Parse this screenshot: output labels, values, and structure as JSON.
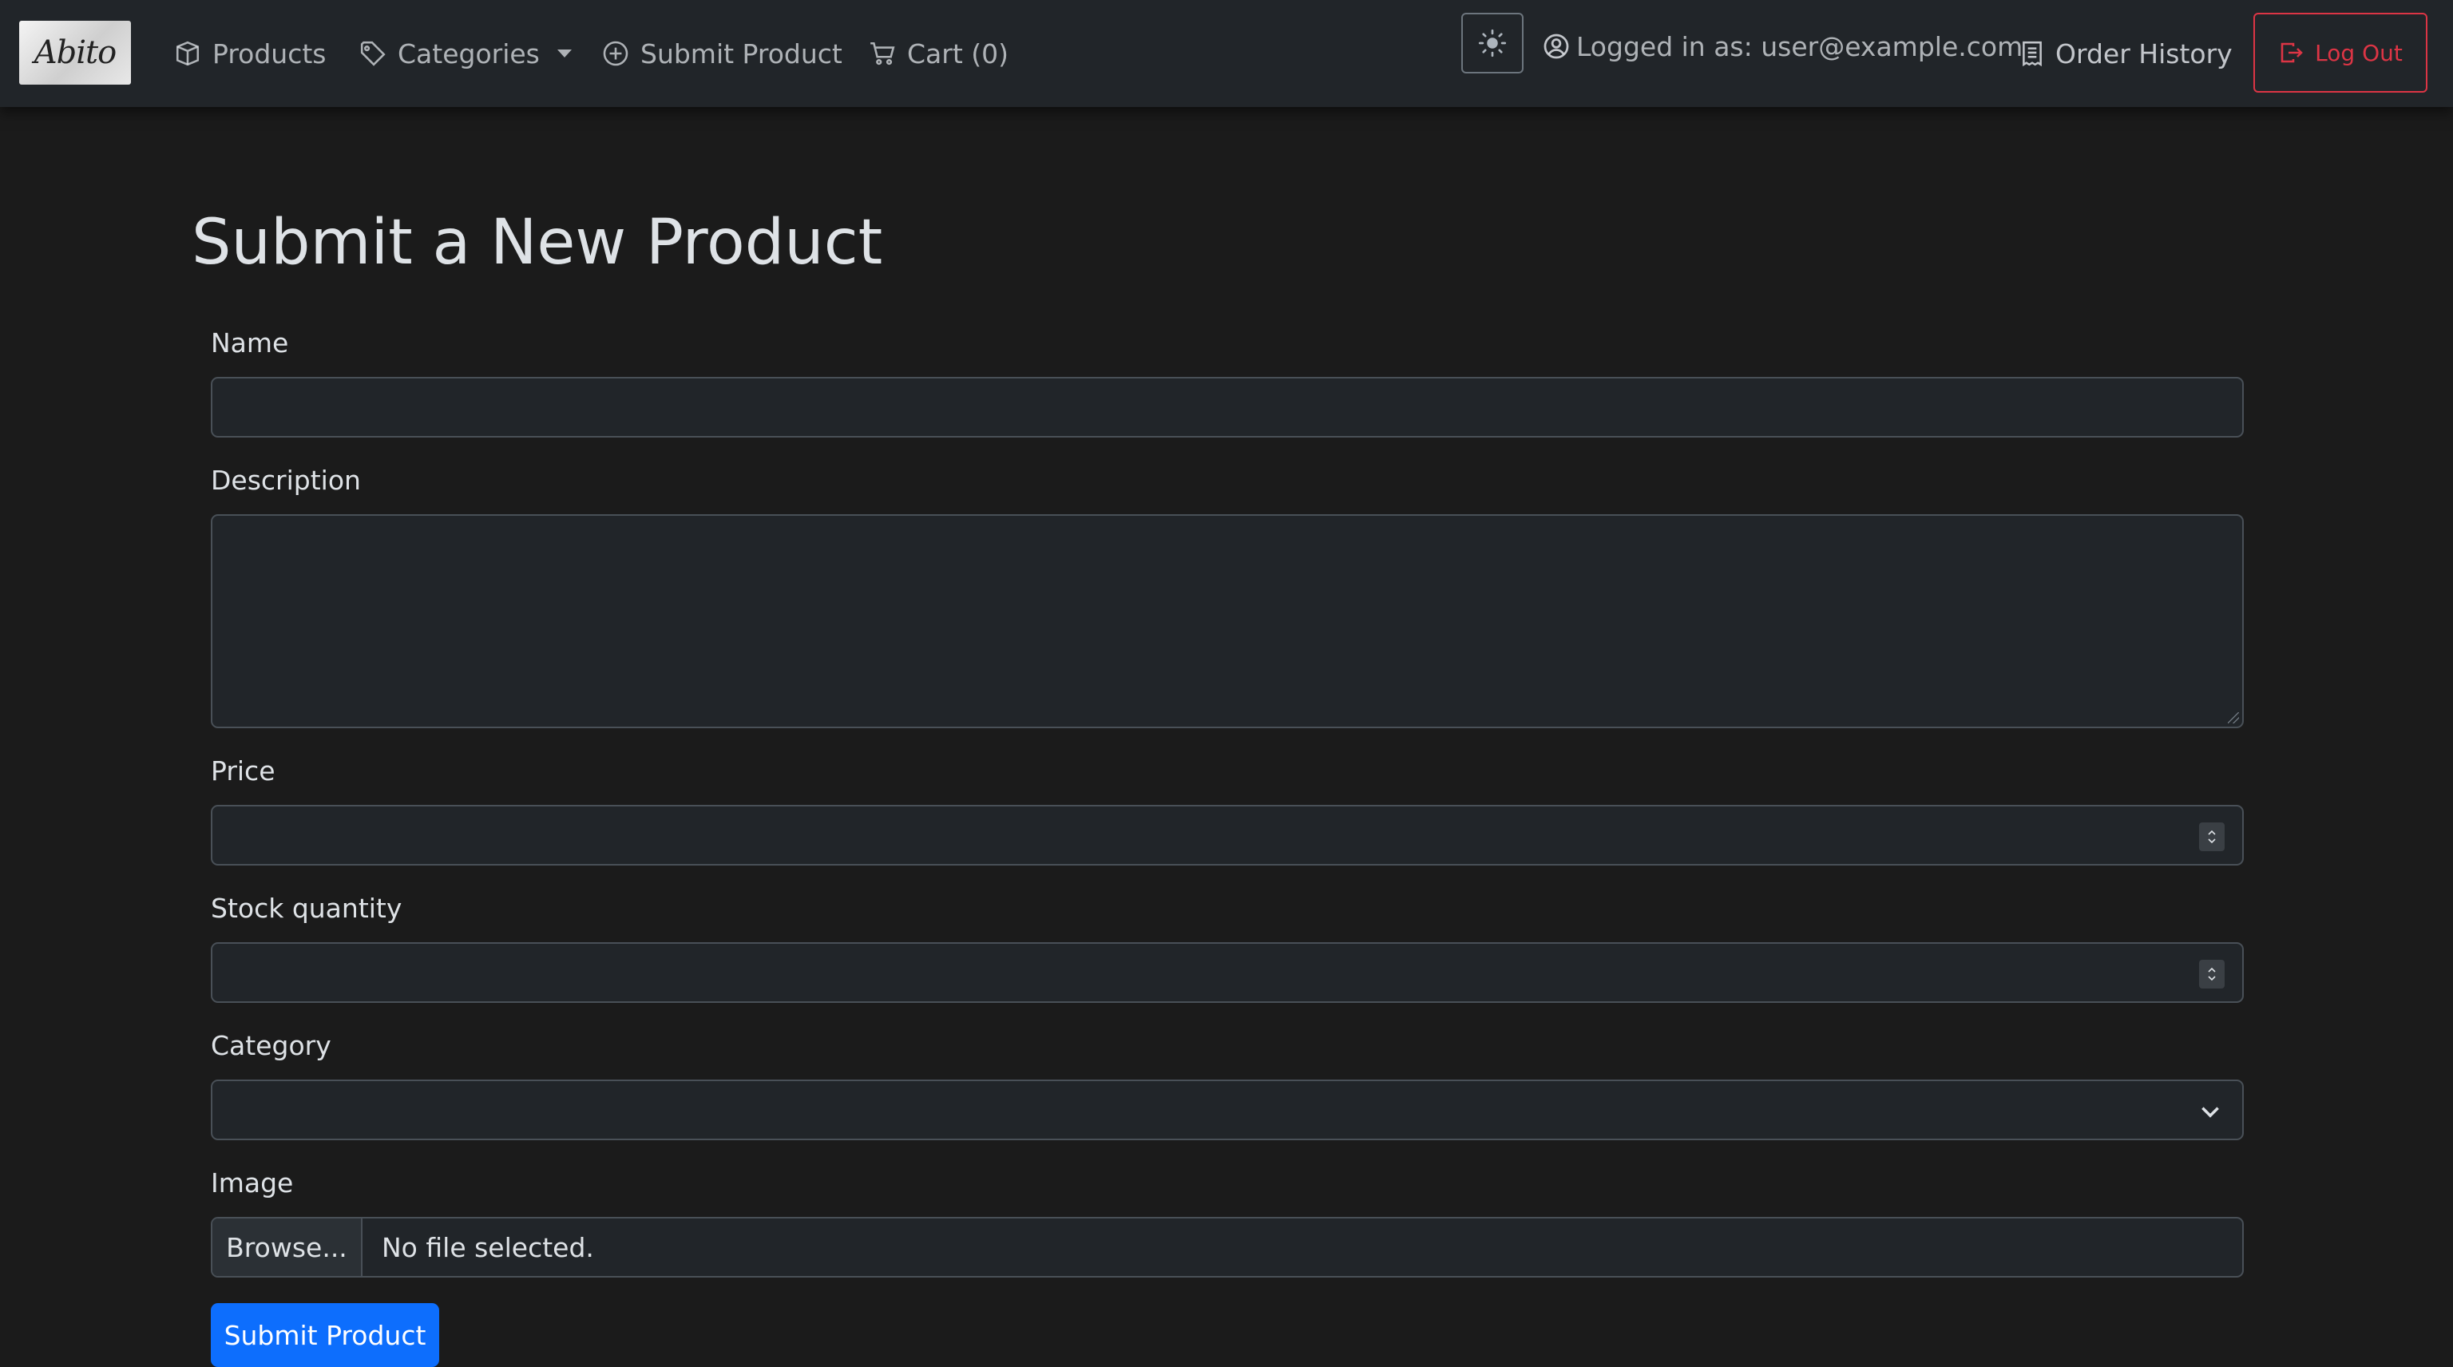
{
  "brand": {
    "logo_text": "Abito"
  },
  "nav": {
    "products": "Products",
    "categories": "Categories",
    "submit_product": "Submit Product",
    "cart": "Cart (0)"
  },
  "user": {
    "logged_in_text": "Logged in as: user@example.com",
    "order_history": "Order History",
    "logout": "Log Out"
  },
  "form": {
    "title": "Submit a New Product",
    "name_label": "Name",
    "name_value": "",
    "description_label": "Description",
    "description_value": "",
    "price_label": "Price",
    "price_value": "",
    "stock_label": "Stock quantity",
    "stock_value": "",
    "category_label": "Category",
    "category_value": "",
    "image_label": "Image",
    "browse_label": "Browse...",
    "file_status": "No file selected.",
    "submit_label": "Submit Product"
  },
  "colors": {
    "background": "#1b1b1b",
    "navbar": "#212529",
    "primary": "#0d6efd",
    "danger": "#dc3545"
  },
  "icons": [
    "box-icon",
    "tag-icon",
    "plus-circle-icon",
    "cart-icon",
    "sun-icon",
    "person-circle-icon",
    "receipt-icon",
    "logout-icon",
    "chevron-down-icon"
  ]
}
